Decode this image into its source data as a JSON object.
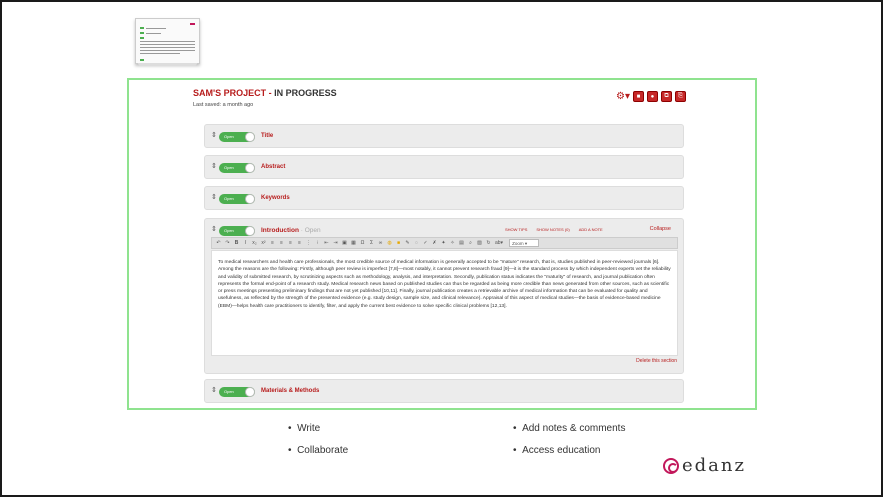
{
  "project": {
    "name": "SAM'S PROJECT - ",
    "status": "IN PROGRESS",
    "last_saved": "Last saved: a month ago"
  },
  "toggle_label": "Open",
  "sections": [
    {
      "name": "Title"
    },
    {
      "name": "Abstract"
    },
    {
      "name": "Keywords"
    },
    {
      "name": "Materials & Methods"
    }
  ],
  "intro": {
    "name": "Introduction",
    "status": " · Open",
    "show_tips": "SHOW TIPS",
    "show_notes": "SHOW NOTES (0)",
    "add_note": "ADD A NOTE",
    "collapse": "Collapse",
    "delete": "Delete this section",
    "zoom": "Zoom",
    "body": "To medical researchers and health care professionals, the most credible source of medical information is generally accepted to be \"mature\" research, that is, studies published in peer-reviewed journals [6]. Among the reasons are the following: Firstly, although peer review is imperfect [7,8]—most notably, it cannot prevent research fraud [9]—it is the standard process by which independent experts vet the reliability and validity of submitted research, by scrutinizing aspects such as methodology, analysis, and interpretation. Secondly, publication status indicates the \"maturity\" of research, and journal publication often represents the formal end-point of a research study. Medical research news based on published studies can thus be regarded as being more credible than news generated from other sources, such as scientific or press meetings presenting preliminary findings that are not yet published [10,11]. Finally, journal publication creates a retrievable archive of medical information that can be evaluated for quality and usefulness, as reflected by the strength of the presented evidence (e.g. study design, sample size, and clinical relevance). Appraisal of this aspect of medical studies—the basis of evidence-based medicine (EBM)—helps health care practitioners to identify, filter, and apply the current best evidence to solve specific clinical problems [12,13]."
  },
  "bullets_left": [
    "Write",
    "Collaborate"
  ],
  "bullets_right": [
    "Add notes & comments",
    "Access education"
  ],
  "logo": "edanz",
  "colors": {
    "accent": "#b71c1c",
    "toggle": "#4caf50",
    "frame": "#8fe38f"
  }
}
